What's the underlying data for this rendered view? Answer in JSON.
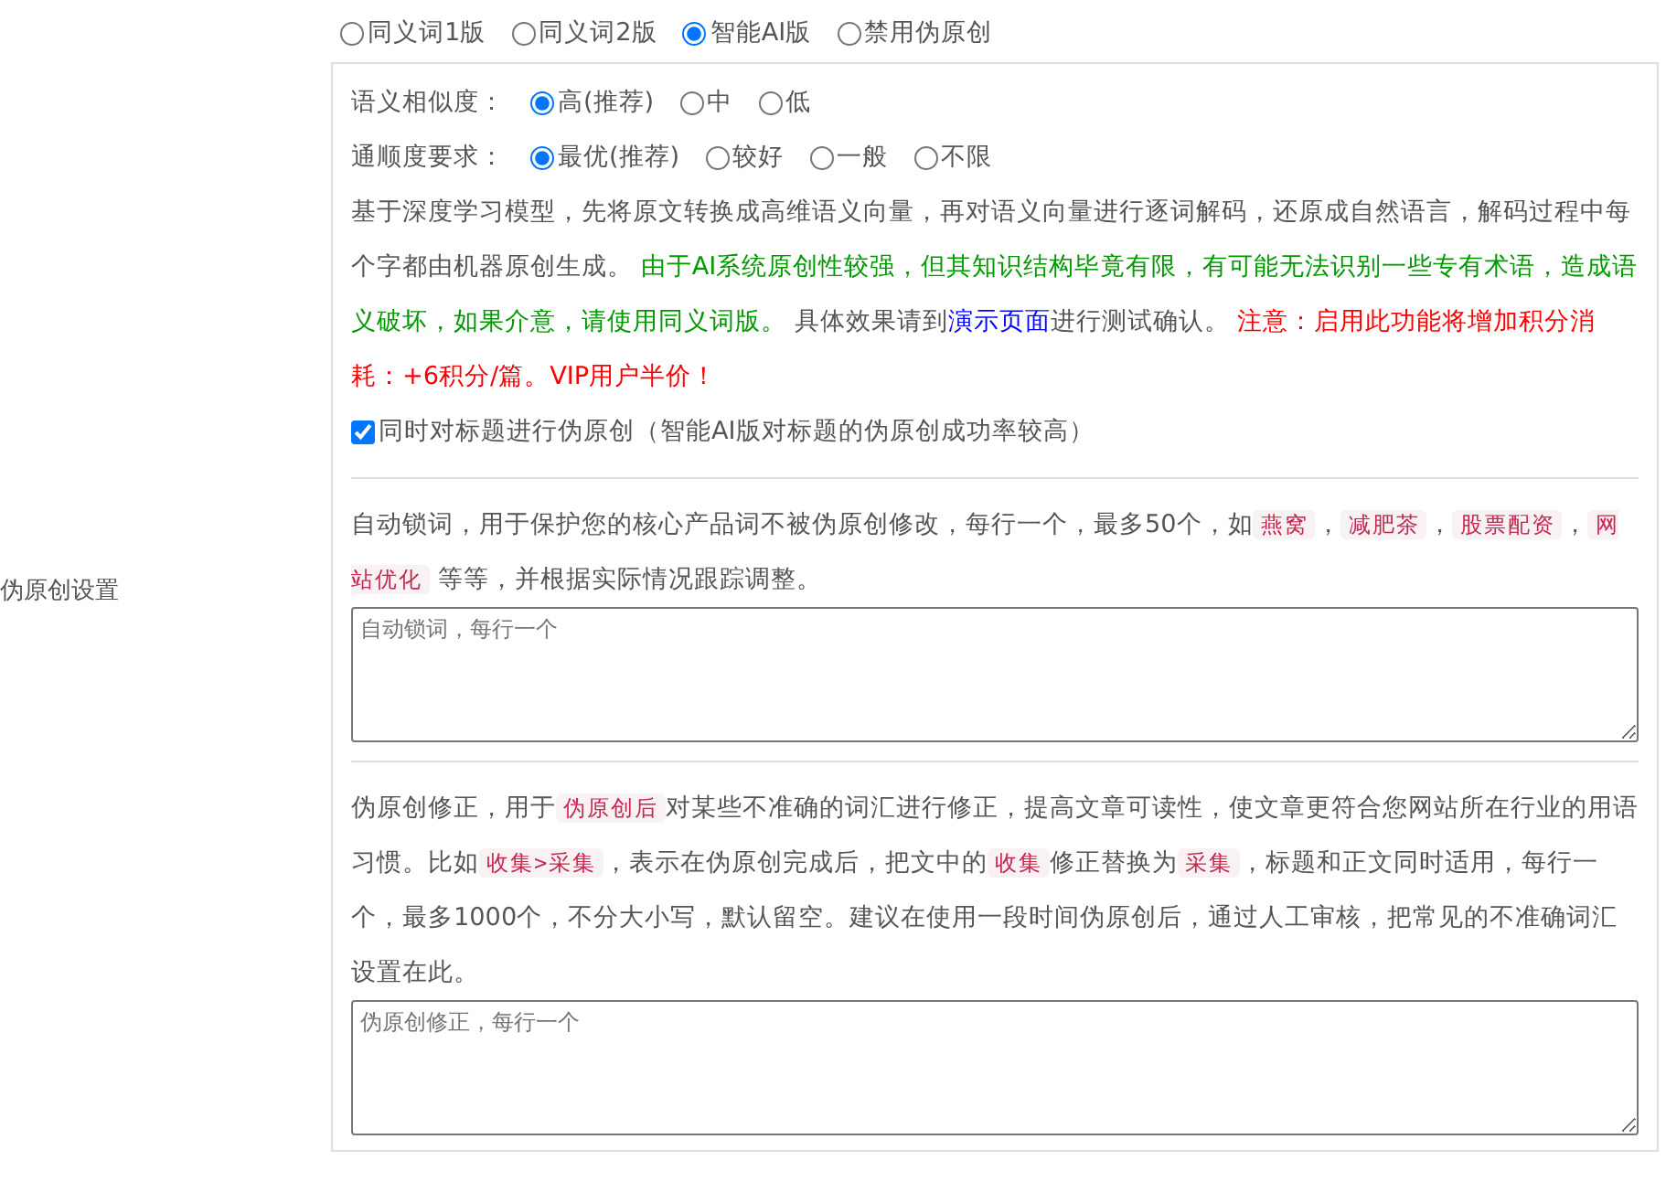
{
  "section_label": "伪原创设置",
  "modes": [
    {
      "label": "同义词1版",
      "selected": false
    },
    {
      "label": "同义词2版",
      "selected": false
    },
    {
      "label": "智能AI版",
      "selected": true
    },
    {
      "label": "禁用伪原创",
      "selected": false
    }
  ],
  "option_groups": [
    {
      "label": "语义相似度：",
      "options": [
        {
          "label": "高(推荐)",
          "selected": true
        },
        {
          "label": "中",
          "selected": false
        },
        {
          "label": "低",
          "selected": false
        }
      ]
    },
    {
      "label": "通顺度要求：",
      "options": [
        {
          "label": "最优(推荐)",
          "selected": true
        },
        {
          "label": "较好",
          "selected": false
        },
        {
          "label": "一般",
          "selected": false
        },
        {
          "label": "不限",
          "selected": false
        }
      ]
    }
  ],
  "ai_description": [
    {
      "kind": "plain",
      "text": "基于深度学习模型，先将原文转换成高维语义向量，再对语义向量进行逐词解码，还原成自然语言，解码过程中每个字都由机器原创生成。 "
    },
    {
      "kind": "green",
      "text": "由于AI系统原创性较强，但其知识结构毕竟有限，有可能无法识别一些专有术语，造成语义破坏，如果介意，请使用同义词版。"
    },
    {
      "kind": "plain",
      "text": " 具体效果请到"
    },
    {
      "kind": "link",
      "text": "演示页面"
    },
    {
      "kind": "plain",
      "text": "进行测试确认。 "
    },
    {
      "kind": "red",
      "text": "注意：启用此功能将增加积分消耗：+6积分/篇。VIP用户半价！"
    }
  ],
  "title_checkbox": {
    "label": "同时对标题进行伪原创（智能AI版对标题的伪原创成功率较高）",
    "checked": true
  },
  "lock_description": [
    {
      "kind": "plain",
      "text": "自动锁词，用于保护您的核心产品词不被伪原创修改，每行一个，最多50个，如"
    },
    {
      "kind": "code",
      "text": "燕窝"
    },
    {
      "kind": "plain",
      "text": "，"
    },
    {
      "kind": "code",
      "text": "减肥茶"
    },
    {
      "kind": "plain",
      "text": "，"
    },
    {
      "kind": "code",
      "text": "股票配资"
    },
    {
      "kind": "plain",
      "text": "，"
    },
    {
      "kind": "code",
      "text": "网站优化"
    },
    {
      "kind": "plain",
      "text": " 等等，并根据实际情况跟踪调整。"
    }
  ],
  "lock_field": {
    "placeholder": "自动锁词，每行一个"
  },
  "fix_description": [
    {
      "kind": "plain",
      "text": "伪原创修正，用于"
    },
    {
      "kind": "code",
      "text": "伪原创后"
    },
    {
      "kind": "plain",
      "text": "对某些不准确的词汇进行修正，提高文章可读性，使文章更符合您网站所在行业的用语习惯。比如"
    },
    {
      "kind": "code",
      "text": "收集>采集"
    },
    {
      "kind": "plain",
      "text": "，表示在伪原创完成后，把文中的"
    },
    {
      "kind": "code",
      "text": "收集"
    },
    {
      "kind": "plain",
      "text": "修正替换为"
    },
    {
      "kind": "code",
      "text": "采集"
    },
    {
      "kind": "plain",
      "text": "，标题和正文同时适用，每行一个，最多1000个，不分大小写，默认留空。建议在使用一段时间伪原创后，通过人工审核，把常见的不准确词汇设置在此。"
    }
  ],
  "fix_field": {
    "placeholder": "伪原创修正，每行一个"
  }
}
